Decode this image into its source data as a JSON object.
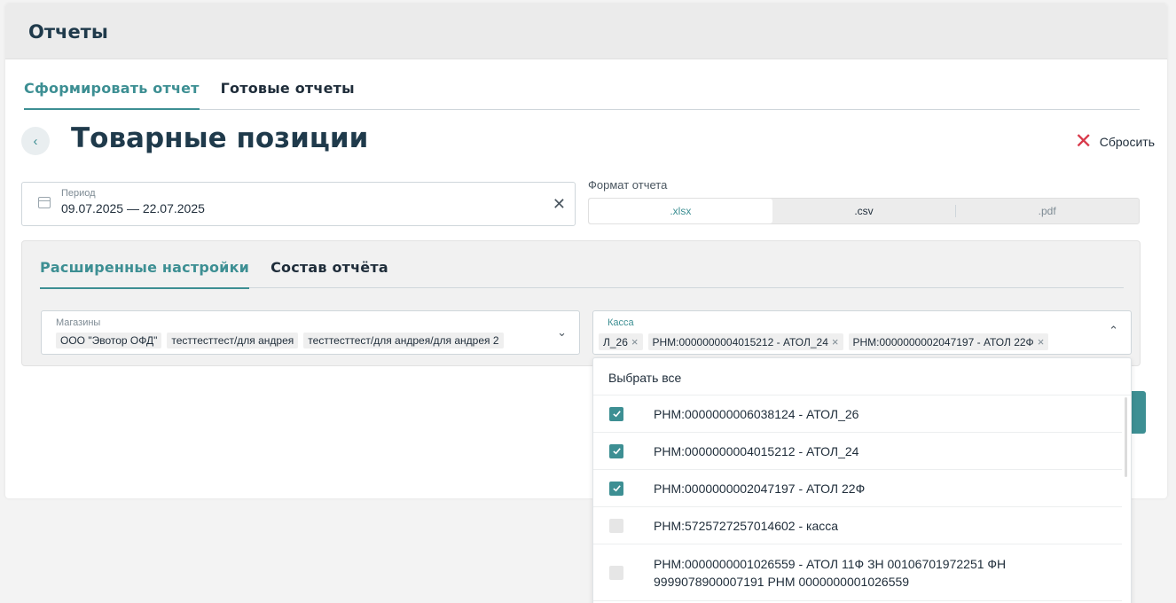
{
  "header": {
    "title": "Отчеты"
  },
  "tabs": [
    {
      "label": "Сформировать отчет",
      "active": true
    },
    {
      "label": "Готовые отчеты",
      "active": false
    }
  ],
  "page": {
    "title": "Товарные позиции",
    "back_icon": "chevron-left-icon",
    "reset_label": "Сбросить",
    "reset_icon": "close-icon"
  },
  "period": {
    "label": "Период",
    "value": "09.07.2025 — 22.07.2025"
  },
  "format": {
    "label": "Формат отчета",
    "options": [
      {
        "label": ".xlsx",
        "selected": true
      },
      {
        "label": ".csv",
        "selected": false
      },
      {
        "label": ".pdf",
        "selected": false
      }
    ]
  },
  "advanced_tabs": [
    {
      "label": "Расширенные настройки",
      "active": true
    },
    {
      "label": "Состав отчёта",
      "active": false
    }
  ],
  "stores": {
    "label": "Магазины",
    "chips": [
      "ООО \"Эвотор ОФД\"",
      "тесттесттест/для андрея",
      "тесттесттест/для андрея/для андрея 2"
    ]
  },
  "kassa": {
    "label": "Касса",
    "chips": [
      "Л_26",
      "РНМ:0000000004015212 - АТОЛ_24",
      "РНМ:0000000002047197 - АТОЛ 22Ф"
    ]
  },
  "dropdown": {
    "select_all": "Выбрать все",
    "items": [
      {
        "label": "РНМ:0000000006038124 - АТОЛ_26",
        "checked": true
      },
      {
        "label": "РНМ:0000000004015212 - АТОЛ_24",
        "checked": true
      },
      {
        "label": "РНМ:0000000002047197 - АТОЛ 22Ф",
        "checked": true
      },
      {
        "label": "РНМ:5725727257014602 - касса",
        "checked": false
      },
      {
        "label": "РНМ:0000000001026559 - АТОЛ 11Ф ЗН 00106701972251 ФН 9999078900007191 РНМ 0000000001026559",
        "checked": false
      }
    ]
  },
  "colors": {
    "accent": "#3d8f93",
    "danger": "#d8394a"
  }
}
